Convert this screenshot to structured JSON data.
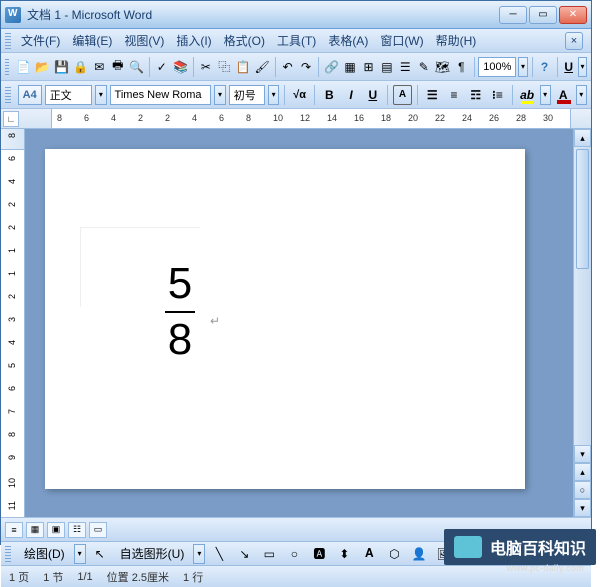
{
  "title": "文档 1 - Microsoft Word",
  "menu": {
    "file": "文件(F)",
    "edit": "编辑(E)",
    "view": "视图(V)",
    "insert": "插入(I)",
    "format": "格式(O)",
    "tools": "工具(T)",
    "table": "表格(A)",
    "window": "窗口(W)",
    "help": "帮助(H)"
  },
  "toolbar": {
    "zoom": "100%"
  },
  "format": {
    "style_indicator": "A4",
    "style": "正文",
    "font": "Times New Roma",
    "size": "初号",
    "bold": "B",
    "italic": "I",
    "underline": "U",
    "fontA": "A"
  },
  "ruler_nums": [
    "8",
    "6",
    "4",
    "2",
    "2",
    "4",
    "6",
    "8",
    "10",
    "12",
    "14",
    "16",
    "18",
    "20",
    "22",
    "24",
    "26",
    "28",
    "30"
  ],
  "ruler_v_nums": [
    "8",
    "6",
    "4",
    "2",
    "2",
    "1",
    "1",
    "2",
    "3",
    "4",
    "5",
    "6",
    "7",
    "8",
    "9",
    "10",
    "11"
  ],
  "equation": {
    "numerator": "5",
    "denominator": "8"
  },
  "draw": {
    "label": "绘图(D)",
    "autoshape": "自选图形(U)"
  },
  "status": {
    "page": "1 页",
    "sec": "1 节",
    "pages": "1/1",
    "pos": "位置 2.5厘米",
    "line": "1 行"
  },
  "watermark": {
    "text": "电脑百科知识",
    "url": "www.pc-daily.com"
  }
}
